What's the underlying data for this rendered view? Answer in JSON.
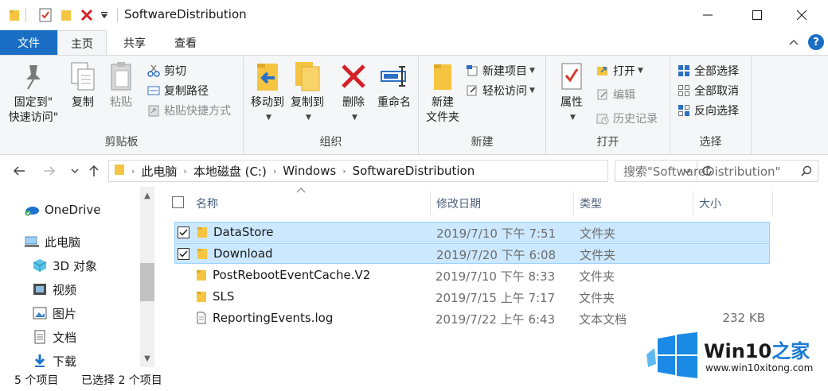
{
  "window": {
    "title": "SoftwareDistribution"
  },
  "tabs": {
    "file": "文件",
    "home": "主页",
    "share": "共享",
    "view": "查看",
    "help": "?"
  },
  "ribbon": {
    "clipboard": {
      "label": "剪贴板",
      "pin_line1": "固定到\"",
      "pin_line2": "快速访问\"",
      "copy": "复制",
      "paste": "粘贴",
      "cut": "剪切",
      "copy_path": "复制路径",
      "paste_shortcut": "粘贴快捷方式"
    },
    "organize": {
      "label": "组织",
      "move_to": "移动到",
      "copy_to": "复制到",
      "delete": "删除",
      "rename": "重命名"
    },
    "new": {
      "label": "新建",
      "new_folder_line1": "新建",
      "new_folder_line2": "文件夹",
      "new_item": "新建项目",
      "easy_access": "轻松访问"
    },
    "open": {
      "label": "打开",
      "properties": "属性",
      "open": "打开",
      "edit": "编辑",
      "history": "历史记录"
    },
    "select": {
      "label": "选择",
      "select_all": "全部选择",
      "select_none": "全部取消",
      "invert": "反向选择"
    }
  },
  "address": {
    "segments": [
      "此电脑",
      "本地磁盘 (C:)",
      "Windows",
      "SoftwareDistribution"
    ],
    "search_placeholder": "搜索\"SoftwareDistribution\""
  },
  "nav": {
    "onedrive": "OneDrive",
    "this_pc": "此电脑",
    "objects3d": "3D 对象",
    "videos": "视频",
    "pictures": "图片",
    "documents": "文档",
    "downloads": "下载"
  },
  "columns": {
    "name": "名称",
    "date": "修改日期",
    "type": "类型",
    "size": "大小"
  },
  "files": [
    {
      "name": "DataStore",
      "date": "2019/7/10 下午 7:51",
      "type": "文件夹",
      "size": "",
      "selected": true,
      "kind": "folder"
    },
    {
      "name": "Download",
      "date": "2019/7/20 下午 6:08",
      "type": "文件夹",
      "size": "",
      "selected": true,
      "kind": "folder"
    },
    {
      "name": "PostRebootEventCache.V2",
      "date": "2019/7/10 下午 8:33",
      "type": "文件夹",
      "size": "",
      "selected": false,
      "kind": "folder"
    },
    {
      "name": "SLS",
      "date": "2019/7/15 上午 7:17",
      "type": "文件夹",
      "size": "",
      "selected": false,
      "kind": "folder"
    },
    {
      "name": "ReportingEvents.log",
      "date": "2019/7/22 上午 6:43",
      "type": "文本文档",
      "size": "232 KB",
      "selected": false,
      "kind": "file"
    }
  ],
  "status": {
    "count": "5 个项目",
    "selected": "已选择 2 个项目"
  },
  "watermark": {
    "title_win": "Win10",
    "title_zh": "之家",
    "url": "www.win10xitong.com"
  },
  "colors": {
    "accent": "#1a6fc4",
    "selection": "#cce8ff",
    "selection_border": "#99d1ff",
    "folder": "#f5c542"
  }
}
